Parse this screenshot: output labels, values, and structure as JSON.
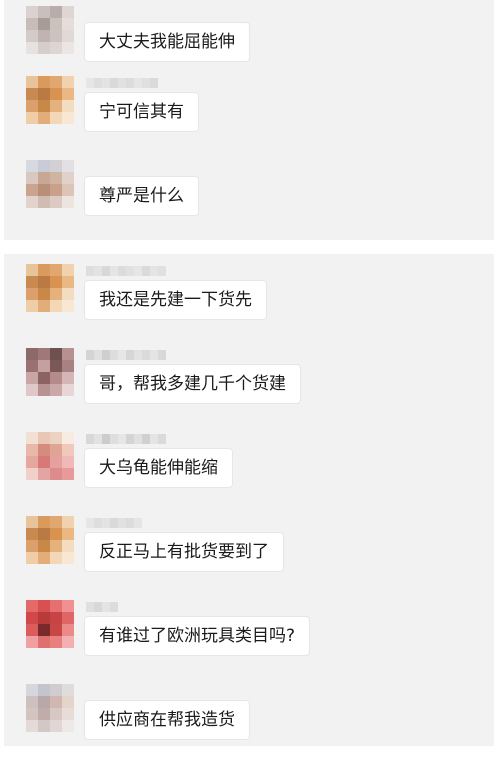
{
  "panels": [
    {
      "messages": [
        {
          "text": "大丈夫我能屈能伸",
          "avatar": [
            "#d9d2d0",
            "#c9bfbc",
            "#b8adaa",
            "#ddd6d3",
            "#c7bcb8",
            "#a89c98",
            "#cbc1bd",
            "#e4ddda",
            "#d3cbc8",
            "#bfb4b1",
            "#ccc3c0",
            "#e0d9d6",
            "#e8e2df",
            "#d6cecb",
            "#dcd5d2",
            "#ebe6e4"
          ],
          "name": []
        },
        {
          "text": "宁可信其有",
          "avatar": [
            "#e8c49a",
            "#d99a5c",
            "#e0a770",
            "#f0d3ae",
            "#c98a52",
            "#b97a44",
            "#d9924f",
            "#e9b883",
            "#dba06b",
            "#c98847",
            "#e5b27e",
            "#f4dcc0",
            "#efcda6",
            "#e2ad78",
            "#f3d7b6",
            "#f8e7d2"
          ],
          "name": [
            "#e6e6e6",
            "#dedede",
            "#e3e3e3",
            "#d9d9d9",
            "#e1e1e1",
            "#dcdcdc",
            "#e5e5e5",
            "#e0e0e0",
            "#dadada"
          ]
        },
        {
          "text": "尊严是什么",
          "avatar": [
            "#d7d9e0",
            "#c9ccd6",
            "#d2d0d4",
            "#e2e0e3",
            "#d8c8c0",
            "#c8a894",
            "#d0b4a2",
            "#e0d2ca",
            "#caa48e",
            "#b98f78",
            "#c9a08a",
            "#dcc4b6",
            "#e2d4cc",
            "#d0bcb0",
            "#dccbc2",
            "#ece4df"
          ],
          "name": []
        }
      ]
    },
    {
      "messages": [
        {
          "text": "我还是先建一下货先",
          "avatar": [
            "#e8c49a",
            "#d99a5c",
            "#e0a770",
            "#f0d3ae",
            "#c98a52",
            "#b97a44",
            "#d9924f",
            "#e9b883",
            "#dba06b",
            "#c98847",
            "#e5b27e",
            "#f4dcc0",
            "#efcda6",
            "#e2ad78",
            "#f3d7b6",
            "#f8e7d2"
          ],
          "name": [
            "#dedede",
            "#e3e3e3",
            "#d8d8d8",
            "#e5e5e5",
            "#dcdcdc",
            "#e1e1e1",
            "#e6e6e6",
            "#dadada",
            "#e4e4e4",
            "#e0e0e0"
          ]
        },
        {
          "text": "哥，帮我多建几千个货建",
          "avatar": [
            "#8a6a6a",
            "#a07878",
            "#6e5050",
            "#b89090",
            "#9a7070",
            "#c4a0a0",
            "#7a5858",
            "#a88282",
            "#c8a6a6",
            "#8c6262",
            "#b48a8a",
            "#d4b6b6",
            "#e0c8c8",
            "#b89292",
            "#caa8a8",
            "#e8d6d6"
          ],
          "name": [
            "#d4d4d4",
            "#e0e0e0",
            "#cfcfcf",
            "#dddddd",
            "#e6e6e6",
            "#d6d6d6",
            "#e2e2e2",
            "#dadada",
            "#e4e4e4",
            "#d8d8d8"
          ]
        },
        {
          "text": "大乌龟能伸能缩",
          "avatar": [
            "#f4e0d2",
            "#e8c8b4",
            "#ecd2c0",
            "#f8ebe2",
            "#e8b8a8",
            "#d68c7c",
            "#e0a494",
            "#f0c8bc",
            "#e4a8a0",
            "#d87878",
            "#e6a0a0",
            "#f0b8b8",
            "#f0d0c8",
            "#e4a4a4",
            "#dc8c8c",
            "#e89a9a"
          ],
          "name": [
            "#d8d8d8",
            "#e2e2e2",
            "#cccccc",
            "#dedede",
            "#e6e6e6",
            "#d4d4d4",
            "#e0e0e0",
            "#d0d0d0",
            "#e4e4e4",
            "#dadada"
          ]
        },
        {
          "text": "反正马上有批货要到了",
          "avatar": [
            "#e8c49a",
            "#d99a5c",
            "#e0a770",
            "#f0d3ae",
            "#c98a52",
            "#b97a44",
            "#d9924f",
            "#e9b883",
            "#dba06b",
            "#c98847",
            "#e5b27e",
            "#f4dcc0",
            "#efcda6",
            "#e2ad78",
            "#f3d7b6",
            "#f8e7d2"
          ],
          "name": [
            "#e6e6e6",
            "#dedede",
            "#e3e3e3",
            "#d9d9d9",
            "#e1e1e1",
            "#dcdcdc",
            "#e5e5e5"
          ]
        },
        {
          "text": "有谁过了欧洲玩具类目吗?",
          "avatar": [
            "#e46a6a",
            "#d85050",
            "#e67070",
            "#f09090",
            "#d24848",
            "#b83a3a",
            "#c84444",
            "#e06666",
            "#dc5c5c",
            "#7a2a2a",
            "#c84646",
            "#ec8a8a",
            "#f0a0a0",
            "#e07070",
            "#e88080",
            "#f4b0b0"
          ],
          "name": [
            "#e0e0e0",
            "#d8d8d8",
            "#e4e4e4",
            "#dcdcdc"
          ]
        },
        {
          "text": "供应商在帮我造货",
          "avatar": [
            "#d6d6de",
            "#c4c4cc",
            "#d0ccd0",
            "#e0dcdc",
            "#ccc0c0",
            "#b8a8a8",
            "#d0b8b0",
            "#e4d4cc",
            "#d4c4c0",
            "#c0aca8",
            "#d8c8c4",
            "#e8dcd8",
            "#e4dad8",
            "#d4c8c6",
            "#e0d6d4",
            "#eee8e6"
          ],
          "name": []
        }
      ]
    }
  ]
}
